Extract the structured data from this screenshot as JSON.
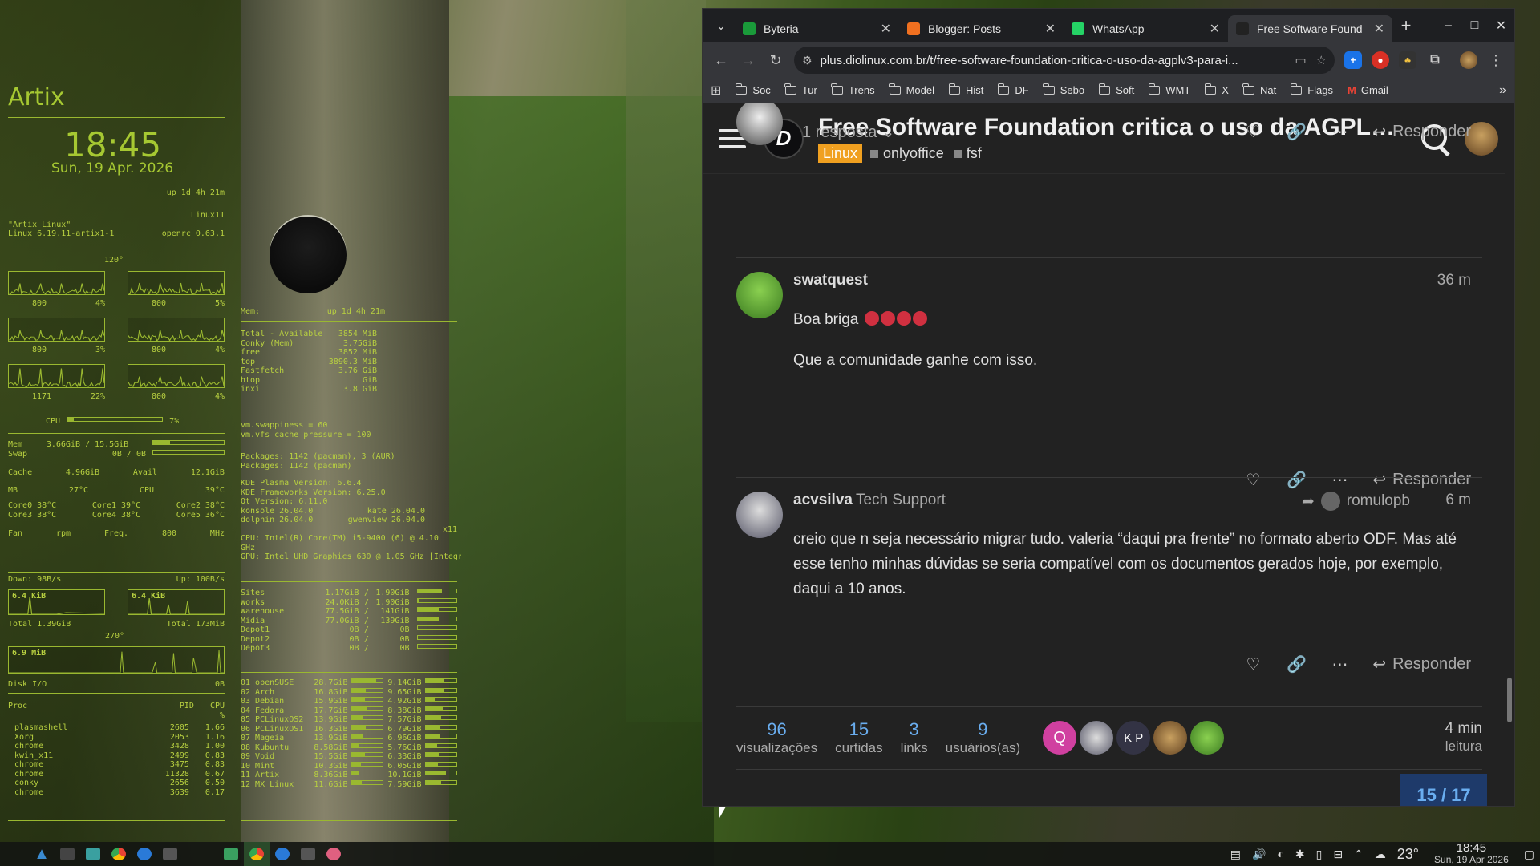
{
  "conky": {
    "title": "Artix",
    "time": "18:45",
    "date": "Sun, 19 Apr. 2026",
    "uptime": "up  1d 4h 21m",
    "hostname": "Linux11",
    "os_name": "\"Artix Linux\"",
    "kernel": "Linux 6.19.11-artix1-1",
    "init": "openrc 0.63.1",
    "cpu_temp_label": "120°",
    "cores": [
      {
        "freq": "800",
        "pct": "4%",
        "pct_v": 0.04
      },
      {
        "freq": "800",
        "pct": "5%",
        "pct_v": 0.05
      },
      {
        "freq": "800",
        "pct": "3%",
        "pct_v": 0.03
      },
      {
        "freq": "800",
        "pct": "4%",
        "pct_v": 0.04
      },
      {
        "freq": "1171",
        "pct": "22%",
        "pct_v": 0.22
      },
      {
        "freq": "800",
        "pct": "4%",
        "pct_v": 0.04
      }
    ],
    "cpu_label": "CPU",
    "cpu_pct": "7%",
    "cpu_fill": 0.07,
    "mem_label": "Mem",
    "mem_val": "3.66GiB / 15.5GiB",
    "mem_fill": 0.24,
    "swap_label": "Swap",
    "swap_val": "0B / 0B",
    "cache_label": "Cache",
    "cache_val": "4.96GiB",
    "avail_label": "Avail",
    "avail_val": "12.1GiB",
    "mb_label": "MB",
    "mb_temp": "27°C",
    "cpu_temp": "39°C",
    "core_temps": [
      "Core0  38°C",
      "Core1  39°C",
      "Core2  38°C",
      "Core3  38°C",
      "Core4  38°C",
      "Core5  36°C"
    ],
    "fan_label": "Fan",
    "fan_val": "rpm",
    "freq_label": "Freq.",
    "freq_val": "800",
    "freq_unit": "MHz",
    "down": "Down: 98B/s",
    "up": "Up: 100B/s",
    "down_graph": "6.4 KiB",
    "up_graph": "6.4 KiB",
    "total_down": "Total 1.39GiB",
    "total_up": "Total 173MiB",
    "net_temp": "270°",
    "disk_graph": "6.9 MiB",
    "disk_label": "Disk I/O",
    "disk_val": "0B",
    "proc_headers": [
      "Proc",
      "PID",
      "CPU",
      "%"
    ],
    "procs": [
      [
        "plasmashell",
        "2605",
        "1.66"
      ],
      [
        "Xorg",
        "2053",
        "1.16"
      ],
      [
        "chrome",
        "3428",
        "1.00"
      ],
      [
        "kwin_x11",
        "2499",
        "0.83"
      ],
      [
        "chrome",
        "3475",
        "0.83"
      ],
      [
        "chrome",
        "11328",
        "0.67"
      ],
      [
        "conky",
        "2656",
        "0.50"
      ],
      [
        "chrome",
        "3639",
        "0.17"
      ]
    ],
    "mem_panel_label": "Mem:",
    "mem_panel_uptime": "up  1d 4h 21m",
    "mem_tools": [
      [
        "Total - Available",
        "3854 MiB"
      ],
      [
        "Conky (Mem)",
        "3.75GiB"
      ],
      [
        "free",
        "3852  MiB"
      ],
      [
        "top",
        "3890.3  MiB"
      ],
      [
        "Fastfetch",
        "3.76 GiB"
      ],
      [
        "htop",
        "GiB"
      ],
      [
        "inxi",
        "3.8 GiB"
      ]
    ],
    "vm": [
      "vm.swappiness = 60",
      "vm.vfs_cache_pressure = 100"
    ],
    "packages": [
      "Packages: 1142 (pacman), 3 (AUR)",
      "Packages: 1142 (pacman)"
    ],
    "versions": [
      [
        "KDE Plasma Version: 6.6.4",
        ""
      ],
      [
        "KDE Frameworks Version: 6.25.0",
        ""
      ],
      [
        "Qt Version: 6.11.0",
        ""
      ],
      [
        "konsole 26.04.0",
        "kate 26.04.0"
      ],
      [
        "dolphin 26.04.0",
        "gwenview 26.04.0"
      ]
    ],
    "x11": "x11",
    "cpu_info": "CPU: Intel(R) Core(TM) i5-9400 (6) @ 4.10 GHz",
    "gpu_info": "GPU: Intel UHD Graphics 630 @ 1.05 GHz [Integr",
    "disks": [
      [
        "Sites",
        "1.17GiB",
        "1.90GiB",
        0.62
      ],
      [
        "Works",
        "24.0KiB",
        "1.90GiB",
        0.01
      ],
      [
        "Warehouse",
        "77.5GiB",
        "141GiB",
        0.55
      ],
      [
        "Midia",
        "77.0GiB",
        "139GiB",
        0.55
      ],
      [
        "Depot1",
        "0B",
        "0B",
        0
      ],
      [
        "Depot2",
        "0B",
        "0B",
        0
      ],
      [
        "Depot3",
        "0B",
        "0B",
        0
      ]
    ],
    "distros": [
      [
        "01 openSUSE",
        "28.7GiB",
        "9.14GiB",
        0.8,
        0.6
      ],
      [
        "02 Arch",
        "16.8GiB",
        "9.65GiB",
        0.45,
        0.6
      ],
      [
        "03 Debian",
        "15.9GiB",
        "4.92GiB",
        0.43,
        0.3
      ],
      [
        "04 Fedora",
        "17.7GiB",
        "8.38GiB",
        0.48,
        0.55
      ],
      [
        "05 PCLinuxOS2",
        "13.9GiB",
        "7.57GiB",
        0.38,
        0.5
      ],
      [
        "06 PCLinuxOS1",
        "16.3GiB",
        "6.79GiB",
        0.44,
        0.45
      ],
      [
        "07 Mageia",
        "13.9GiB",
        "6.96GiB",
        0.38,
        0.45
      ],
      [
        "08 Kubuntu",
        "8.58GiB",
        "5.76GiB",
        0.23,
        0.38
      ],
      [
        "09 Void",
        "15.5GiB",
        "6.33GiB",
        0.42,
        0.42
      ],
      [
        "10 Mint",
        "10.3GiB",
        "6.05GiB",
        0.28,
        0.4
      ],
      [
        "11 Artix",
        "8.36GiB",
        "10.1GiB",
        0.22,
        0.65
      ],
      [
        "12 MX Linux",
        "11.6GiB",
        "7.59GiB",
        0.31,
        0.5
      ]
    ]
  },
  "browser": {
    "tabs": [
      {
        "title": "Byteria",
        "icon": "byteria-favicon",
        "color": "#1a9a3a"
      },
      {
        "title": "Blogger: Posts",
        "icon": "blogger-favicon",
        "color": "#f07020"
      },
      {
        "title": "WhatsApp",
        "icon": "whatsapp-favicon",
        "color": "#25d366"
      },
      {
        "title": "Free Software Found",
        "icon": "diolinux-favicon",
        "color": "#222222",
        "active": true
      }
    ],
    "url": "plus.diolinux.com.br/t/free-software-foundation-critica-o-uso-da-agplv3-para-i...",
    "bookmarks": [
      "Soc",
      "Tur",
      "Trens",
      "Model",
      "Hist",
      "DF",
      "Sebo",
      "Soft",
      "WMT",
      "X",
      "Nat",
      "Flags",
      "Gmail"
    ]
  },
  "page": {
    "topic_title": "Free Software Foundation critica o uso da AGPLv3...",
    "category": "Linux",
    "tags": [
      "onlyoffice",
      "fsf"
    ],
    "reply_count_label": "1 resposta",
    "reply_label": "Responder",
    "posts": [
      {
        "author": "swatquest",
        "title": "",
        "time": "36 m",
        "body": [
          "Boa briga",
          "Que a comunidade ganhe com isso."
        ]
      },
      {
        "author": "acvsilva",
        "title": "Tech Support",
        "time": "6 m",
        "reply_to": "romulopb",
        "body": [
          "creio que n seja necessário migrar tudo. valeria “daqui pra frente” no formato aberto ODF. Mas até esse tenho minhas dúvidas se seria compatível com os documentos gerados hoje, por exemplo, daqui a 10 anos."
        ]
      }
    ],
    "stats": [
      {
        "n": "96",
        "l": "visualizações"
      },
      {
        "n": "15",
        "l": "curtidas"
      },
      {
        "n": "3",
        "l": "links"
      },
      {
        "n": "9",
        "l": "usuários(as)"
      }
    ],
    "participants": [
      "Q",
      "",
      "K P",
      "",
      ""
    ],
    "read_time": "4 min",
    "read_label": "leitura",
    "progress": "15 / 17"
  },
  "taskbar": {
    "temp": "23°",
    "clock_time": "18:45",
    "clock_date": "Sun, 19 Apr 2026"
  }
}
